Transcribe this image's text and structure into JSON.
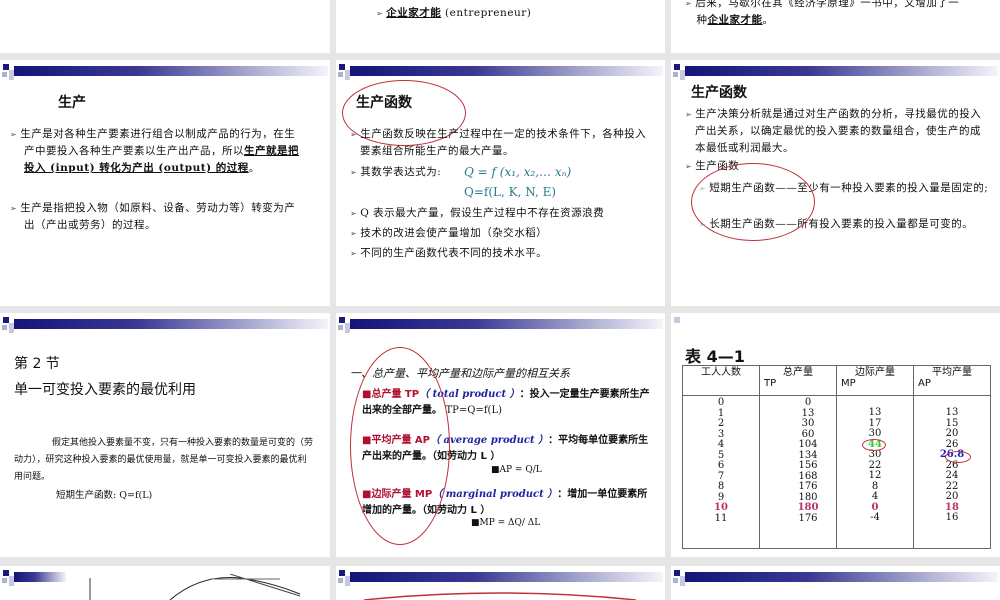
{
  "slides_top": {
    "s2_bullet": "企业家才能",
    "s2_suffix": " (entrepreneur)",
    "s3_line1": "后来，马歇尔在其《经济学原理》一书中，又增加了一",
    "s3_line2_pre": "种",
    "s3_line2_u": "企业家才能",
    "s3_line2_post": "。"
  },
  "slide_production": {
    "title": "生产",
    "b1_text": "生产是对各种生产要素进行组合以制成产品的行为，在生产中要投入各种生产要素以生产出产品，所以",
    "b1_underline": "生产就是把投入 (input) 转化为产出 (output) 的过程",
    "b1_end": "。",
    "b2": "生产是指把投入物（如原料、设备、劳动力等）转变为产出（产出或劳务）的过程。"
  },
  "slide_function": {
    "title": "生产函数",
    "b1": "生产函数反映在生产过程中在一定的技术条件下，各种投入要素组合所能生产的最大产量。",
    "b2": "其数学表达式为:",
    "formula1": "Q = f (x₁, x₂,… xₙ)",
    "formula2": "Q=f(L, K, N, E)",
    "b3": "Q 表示最大产量，假设生产过程中不存在资源浪费",
    "b4": "技术的改进会使产量增加（杂交水稻）",
    "b5": "不同的生产函数代表不同的技术水平。"
  },
  "slide_function2": {
    "title": "生产函数",
    "b1": "生产决策分析就是通过对生产函数的分析，寻找最优的投入产出关系，以确定最优的投入要素的数量组合，使生产的成本最低或利润最大。",
    "b2": "生产函数",
    "sub1": "短期生产函数——至少有一种投入要素的投入量是固定的;",
    "sub2": "长期生产函数——所有投入要素的投入量都是可变的。"
  },
  "slide_section2": {
    "heading": "第 2 节",
    "title": "单一可变投入要素的最优利用",
    "para": "假定其他投入要素量不变，只有一种投入要素的数量是可变的（劳动力），研究这种投入要素的最优使用量，就是单一可变投入要素的最优利用问题。",
    "short_run": "短期生产函数:  Q=f(L)"
  },
  "slide_relations": {
    "title": "一、总产量、平均产量和边际产量的相互关系",
    "tp_label": "■总产量 TP",
    "tp_en": "（ total product ）",
    "tp_desc": "：投入一定量生产要素所生产出来的全部产量。",
    "tp_formula": "TP=Q=f(L)",
    "ap_label": "■平均产量 AP",
    "ap_en": "（ average product ）",
    "ap_desc": "：平均每单位要素所生产出来的产量。（如劳动力 L ）",
    "ap_formula": "■AP = Q/L",
    "mp_label": "■边际产量 MP",
    "mp_en": "（ marginal product ）",
    "mp_desc": "：增加一单位要素所增加的产量。（如劳动力 L ）",
    "mp_formula": "■MP = ΔQ/ ΔL"
  },
  "slide_table": {
    "title": "表 4—1",
    "headers": [
      [
        "工人人数",
        ""
      ],
      [
        "总产量",
        "TP"
      ],
      [
        "边际产量",
        "MP"
      ],
      [
        "平均产量",
        "AP"
      ]
    ],
    "workers": [
      "0",
      "1",
      "2",
      "3",
      "4",
      "5",
      "6",
      "7",
      "8",
      "9",
      "10",
      "11"
    ],
    "tp": [
      "0",
      "13",
      "30",
      "60",
      "104",
      "134",
      "156",
      "168",
      "176",
      "180",
      "180",
      "176"
    ],
    "mp": [
      "13",
      "17",
      "30",
      "44",
      "30",
      "22",
      "12",
      "8",
      "4",
      "0",
      "-4"
    ],
    "ap": [
      "13",
      "15",
      "20",
      "26",
      "26.8",
      "26",
      "24",
      "22",
      "20",
      "18",
      "16"
    ],
    "highlight_color": "#c0306a",
    "mp_max_color": "#40c040",
    "ap_max_color": "#2020c0"
  }
}
